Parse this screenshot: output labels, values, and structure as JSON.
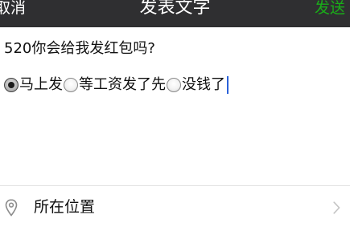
{
  "nav": {
    "cancel_label": "取消",
    "title": "发表文字",
    "send_label": "发送"
  },
  "post": {
    "line1": "520你会给我发红包吗?",
    "options": [
      {
        "label": "马上发",
        "checked": true
      },
      {
        "label": "等工资发了先",
        "checked": false
      },
      {
        "label": "没钱了",
        "checked": false
      }
    ]
  },
  "location": {
    "label": "所在位置",
    "icon": "location-pin-icon",
    "chevron": "chevron-right-icon"
  },
  "colors": {
    "nav_bg": "#2f2f31",
    "send": "#1aad19",
    "caret": "#2b62d9"
  }
}
